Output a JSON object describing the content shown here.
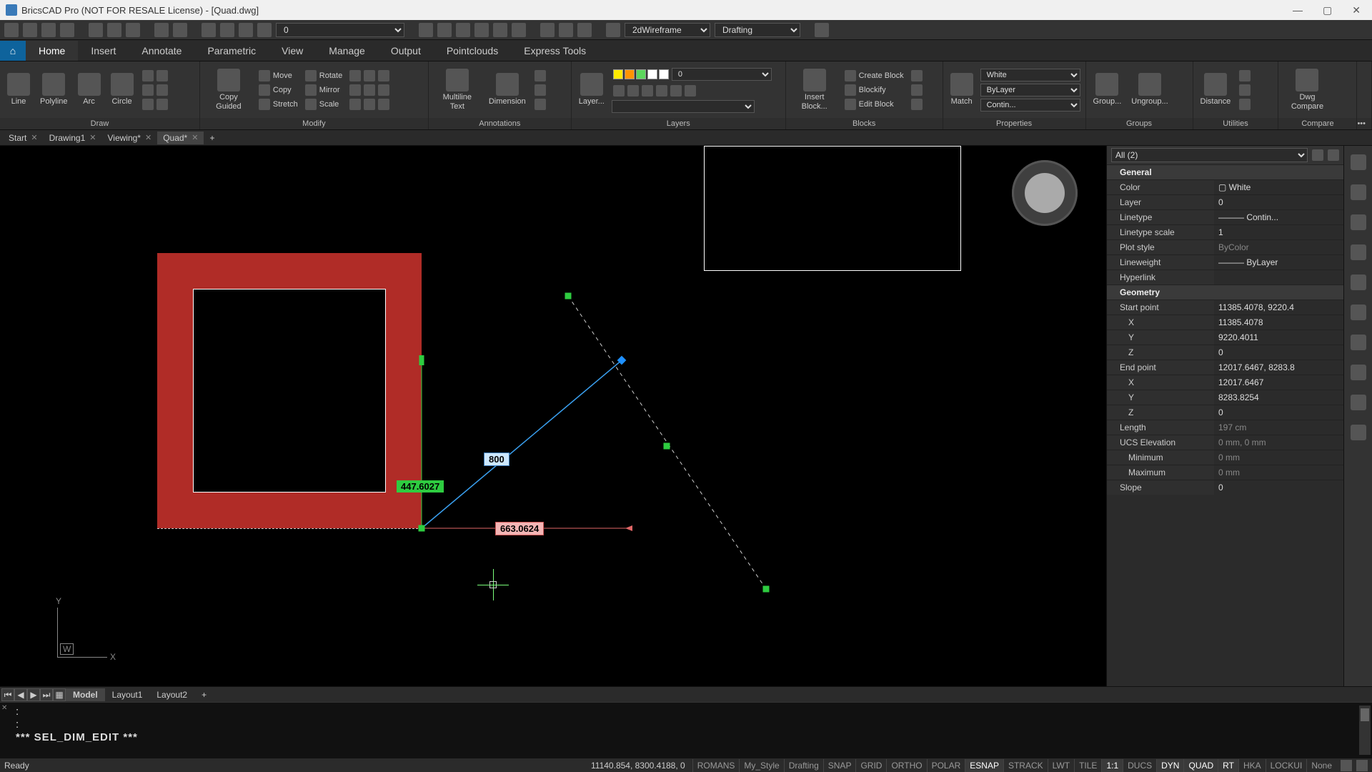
{
  "app": {
    "title": "BricsCAD Pro (NOT FOR RESALE License) - [Quad.dwg]"
  },
  "quickbar": {
    "layer_sel": "0",
    "visual_style": "2dWireframe",
    "workspace": "Drafting"
  },
  "menus": [
    "Home",
    "Insert",
    "Annotate",
    "Parametric",
    "View",
    "Manage",
    "Output",
    "Pointclouds",
    "Express Tools"
  ],
  "ribbon": {
    "draw": {
      "title": "Draw",
      "line": "Line",
      "polyline": "Polyline",
      "arc": "Arc",
      "circle": "Circle"
    },
    "modify": {
      "title": "Modify",
      "copy_guided": "Copy Guided",
      "move": "Move",
      "rotate": "Rotate",
      "copy": "Copy",
      "mirror": "Mirror",
      "stretch": "Stretch",
      "scale": "Scale"
    },
    "annotations": {
      "title": "Annotations",
      "mtext": "Multiline Text",
      "dim": "Dimension"
    },
    "layers": {
      "title": "Layers",
      "btn": "Layer...",
      "sel": "0"
    },
    "blocks": {
      "title": "Blocks",
      "insert": "Insert Block...",
      "create": "Create Block",
      "blockify": "Blockify",
      "edit": "Edit Block"
    },
    "properties": {
      "title": "Properties",
      "match": "Match",
      "color": "White",
      "bylayer": "ByLayer",
      "contin": "Contin..."
    },
    "groups": {
      "title": "Groups",
      "group": "Group...",
      "ungroup": "Ungroup..."
    },
    "utilities": {
      "title": "Utilities",
      "dist": "Distance"
    },
    "compare": {
      "title": "Compare",
      "dwg": "Dwg Compare"
    }
  },
  "doctabs": [
    {
      "label": "Start",
      "active": false,
      "closable": true
    },
    {
      "label": "Drawing1",
      "active": false,
      "closable": true
    },
    {
      "label": "Viewing*",
      "active": false,
      "closable": true
    },
    {
      "label": "Quad*",
      "active": true,
      "closable": true
    }
  ],
  "canvas": {
    "dim_blue": "800",
    "dim_green": "447.6027",
    "dim_red": "663.0624",
    "ucs_w": "W",
    "axis_x": "X",
    "axis_y": "Y"
  },
  "props": {
    "selector": "All (2)",
    "general_hdr": "General",
    "color_k": "Color",
    "color_v": "White",
    "layer_k": "Layer",
    "layer_v": "0",
    "ltype_k": "Linetype",
    "ltype_v": "Contin...",
    "ltscale_k": "Linetype scale",
    "ltscale_v": "1",
    "plot_k": "Plot style",
    "plot_v": "ByColor",
    "lw_k": "Lineweight",
    "lw_v": "ByLayer",
    "hyper_k": "Hyperlink",
    "hyper_v": "",
    "geom_hdr": "Geometry",
    "sp_k": "Start point",
    "sp_v": "11385.4078, 9220.4",
    "spx_k": "X",
    "spx_v": "11385.4078",
    "spy_k": "Y",
    "spy_v": "9220.4011",
    "spz_k": "Z",
    "spz_v": "0",
    "ep_k": "End point",
    "ep_v": "12017.6467, 8283.8",
    "epx_k": "X",
    "epx_v": "12017.6467",
    "epy_k": "Y",
    "epy_v": "8283.8254",
    "epz_k": "Z",
    "epz_v": "0",
    "len_k": "Length",
    "len_v": "197 cm",
    "ucs_k": "UCS Elevation",
    "ucs_v": "0 mm, 0 mm",
    "min_k": "Minimum",
    "min_v": "0 mm",
    "max_k": "Maximum",
    "max_v": "0 mm",
    "slope_k": "Slope",
    "slope_v": "0"
  },
  "layouts": {
    "model": "Model",
    "l1": "Layout1",
    "l2": "Layout2"
  },
  "cmd": {
    "line1": ":",
    "line2": ":",
    "line3": "*** SEL_DIM_EDIT ***"
  },
  "status": {
    "ready": "Ready",
    "coords": "11140.854, 8300.4188, 0",
    "text1": "ROMANS",
    "text2": "My_Style",
    "text3": "Drafting",
    "toggles": [
      "SNAP",
      "GRID",
      "ORTHO",
      "POLAR",
      "ESNAP",
      "STRACK",
      "LWT",
      "TILE",
      "1:1",
      "DUCS",
      "DYN",
      "QUAD",
      "RT",
      "HKA",
      "LOCKUI",
      "None"
    ],
    "toggles_on": [
      4,
      8,
      10,
      11,
      12
    ]
  }
}
